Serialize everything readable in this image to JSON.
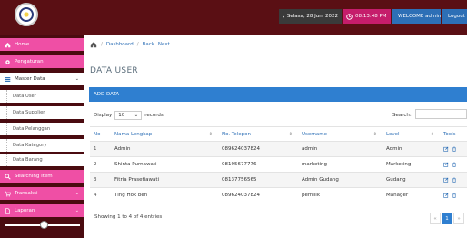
{
  "topbar": {
    "date": "Selasa, 28 Juni 2022",
    "time": "08:13:48 PM",
    "welcome": "WELCOME admin",
    "logout": "Logout"
  },
  "sidebar": {
    "home": "Home",
    "pengaturan": "Pengaturan",
    "master_data": "Master Data",
    "sub_items": [
      "Data User",
      "Data Supplier",
      "Data Pelanggan",
      "Data Kategory",
      "Data Barang"
    ],
    "searching": "Searching Item",
    "transaksi": "Transaksi",
    "laporan": "Laporan"
  },
  "breadcrumb": {
    "dashboard": "Dashboard",
    "back": "Back",
    "next": "Next"
  },
  "page_title": "DATA USER",
  "panel_title": "ADD DATA",
  "table_controls": {
    "display": "Display",
    "entries_value": "10",
    "records": "records",
    "search": "Search:"
  },
  "table": {
    "headers": [
      "No",
      "Nama Lengkap",
      "No. Telepon",
      "Username",
      "Level",
      "Tools"
    ],
    "rows": [
      [
        "1",
        "Admin",
        "089624037824",
        "admin",
        "Admin"
      ],
      [
        "2",
        "Shinta Purnawati",
        "08195677776",
        "marketing",
        "Marketing"
      ],
      [
        "3",
        "Fitria Prasetiawati",
        "08137756565",
        "Admin Gudang",
        "Gudang"
      ],
      [
        "4",
        "Ting Hok ben",
        "089624037824",
        "pemilik",
        "Manager"
      ]
    ]
  },
  "footer": {
    "info": "Showing 1 to 4 of 4 entries",
    "prev": "«",
    "page": "1",
    "next": "»"
  },
  "colors": {
    "topbar": "#5a0f14",
    "sidebar_pink": "#ef4fa5",
    "accent_blue": "#2f7fd0"
  }
}
